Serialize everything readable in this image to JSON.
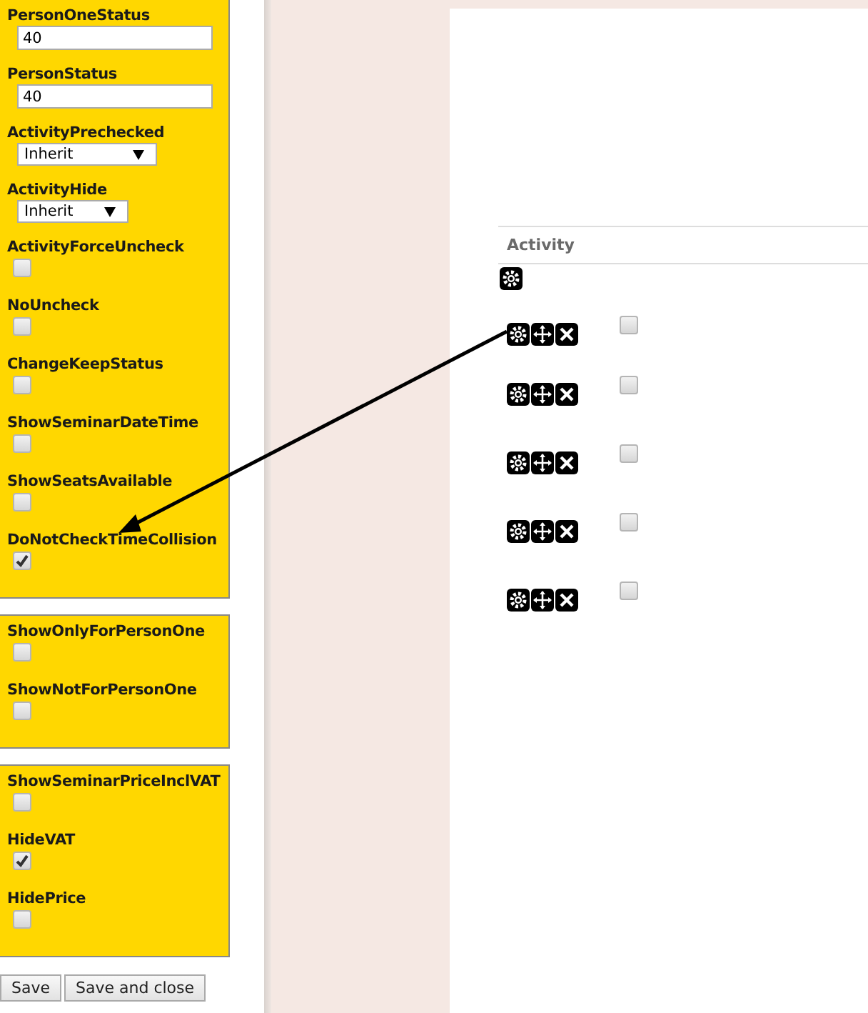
{
  "settings_groups": [
    {
      "fields": [
        {
          "kind": "text",
          "label": "PersonOneStatus",
          "value": "40"
        },
        {
          "kind": "text",
          "label": "PersonStatus",
          "value": "40"
        },
        {
          "kind": "select",
          "label": "ActivityPrechecked",
          "value": "Inherit"
        },
        {
          "kind": "select",
          "label": "ActivityHide",
          "value": "Inherit"
        },
        {
          "kind": "checkbox",
          "label": "ActivityForceUncheck",
          "checked": false
        },
        {
          "kind": "checkbox",
          "label": "NoUncheck",
          "checked": false
        },
        {
          "kind": "checkbox",
          "label": "ChangeKeepStatus",
          "checked": false
        },
        {
          "kind": "checkbox",
          "label": "ShowSeminarDateTime",
          "checked": false
        },
        {
          "kind": "checkbox",
          "label": "ShowSeatsAvailable",
          "checked": false
        },
        {
          "kind": "checkbox",
          "label": "DoNotCheckTimeCollision",
          "checked": true
        }
      ]
    },
    {
      "fields": [
        {
          "kind": "checkbox",
          "label": "ShowOnlyForPersonOne",
          "checked": false
        },
        {
          "kind": "checkbox",
          "label": "ShowNotForPersonOne",
          "checked": false
        }
      ]
    },
    {
      "fields": [
        {
          "kind": "checkbox",
          "label": "ShowSeminarPriceInclVAT",
          "checked": false
        },
        {
          "kind": "checkbox",
          "label": "HideVAT",
          "checked": true
        },
        {
          "kind": "checkbox",
          "label": "HidePrice",
          "checked": false
        }
      ]
    }
  ],
  "buttons": [
    "Save",
    "Save and close"
  ],
  "table": {
    "columns": [
      "Activity"
    ],
    "rows": [
      {
        "kind": "root"
      },
      {
        "kind": "item",
        "checked": false
      },
      {
        "kind": "item",
        "checked": false
      },
      {
        "kind": "item",
        "checked": false
      },
      {
        "kind": "item",
        "checked": false
      },
      {
        "kind": "item",
        "checked": false
      }
    ]
  }
}
